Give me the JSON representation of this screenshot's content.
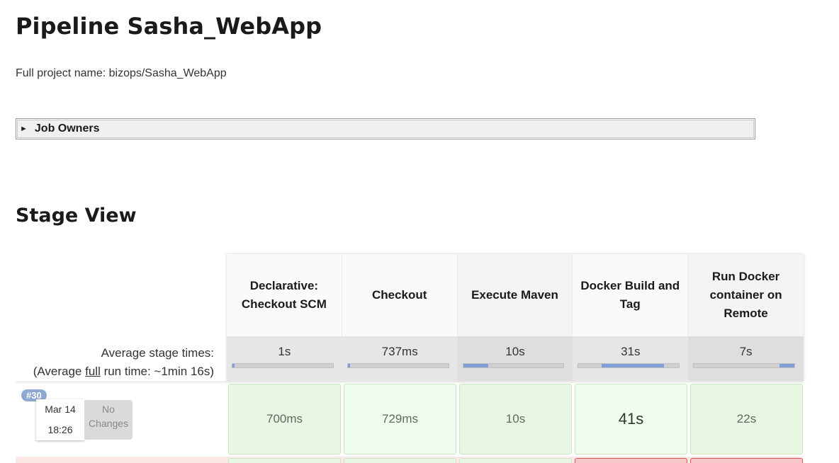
{
  "page": {
    "title": "Pipeline Sasha_WebApp",
    "full_name": "Full project name: bizops/Sasha_WebApp"
  },
  "job_owners": {
    "arrow": "►",
    "label": "Job Owners"
  },
  "stage_view": {
    "title": "Stage View",
    "avg_label": "Average stage times:",
    "avg_full_prefix": "(Average ",
    "avg_full_link": "full",
    "avg_full_suffix": " run time: ~1min 16s)",
    "stages": [
      {
        "name": "Declarative: Checkout SCM",
        "avg": "1s",
        "bar": {
          "start": 0,
          "fill": 0.02
        }
      },
      {
        "name": "Checkout",
        "avg": "737ms",
        "bar": {
          "start": 0,
          "fill": 0.02
        }
      },
      {
        "name": "Execute Maven",
        "avg": "10s",
        "bar": {
          "start": 0,
          "fill": 0.25
        }
      },
      {
        "name": "Docker Build and Tag",
        "avg": "31s",
        "bar": {
          "start": 0.23,
          "fill": 0.62
        }
      },
      {
        "name": "Run Docker container on Remote",
        "avg": "7s",
        "bar": {
          "start": 0.85,
          "fill": 0.15
        }
      }
    ],
    "runs": [
      {
        "badge": "#30",
        "date": "Mar 14",
        "time": "18:26",
        "changes": "No Changes",
        "cells": [
          "700ms",
          "729ms",
          "10s",
          "41s",
          "22s"
        ]
      }
    ]
  }
}
